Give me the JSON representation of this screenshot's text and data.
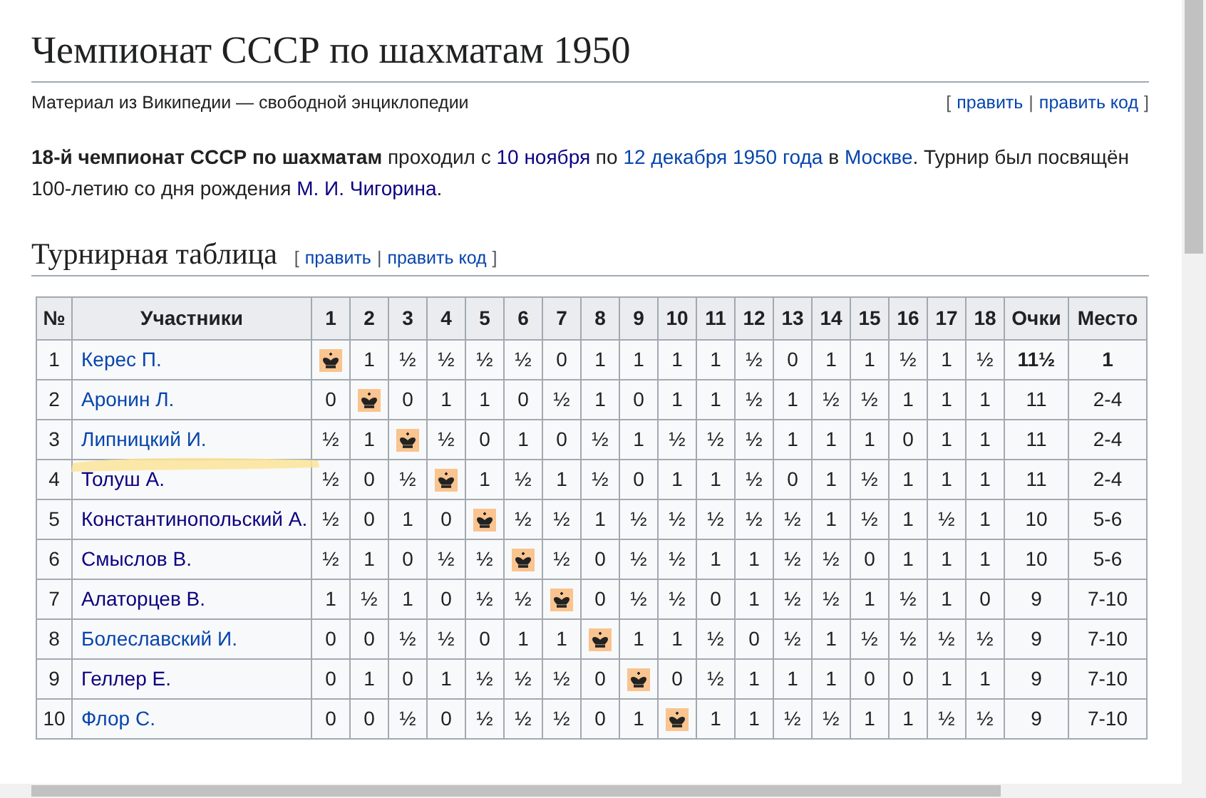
{
  "title": "Чемпионат СССР по шахматам 1950",
  "tagline": "Материал из Википедии — свободной энциклопедии",
  "page_edit": {
    "open": "[",
    "links": [
      "править",
      "править код"
    ],
    "separator": "|",
    "close": "]"
  },
  "intro": [
    {
      "kind": "bold",
      "text": "18-й чемпионат СССР по шахматам"
    },
    {
      "kind": "plain",
      "text": " проходил с "
    },
    {
      "kind": "link",
      "text": "10 ноября",
      "visited": true
    },
    {
      "kind": "plain",
      "text": " по "
    },
    {
      "kind": "link",
      "text": "12 декабря 1950 года",
      "visited": false
    },
    {
      "kind": "plain",
      "text": " в "
    },
    {
      "kind": "link",
      "text": "Москве",
      "visited": false
    },
    {
      "kind": "plain",
      "text": ". Турнир был посвящён 100-летию со дня рождения "
    },
    {
      "kind": "link",
      "text": "М. И. Чигорина",
      "visited": true
    },
    {
      "kind": "plain",
      "text": "."
    }
  ],
  "section": {
    "title": "Турнирная таблица",
    "edit": {
      "open": "[",
      "links": [
        "править",
        "править код"
      ],
      "separator": "|",
      "close": "]"
    }
  },
  "table": {
    "columns": [
      "№",
      "Участники",
      "1",
      "2",
      "3",
      "4",
      "5",
      "6",
      "7",
      "8",
      "9",
      "10",
      "11",
      "12",
      "13",
      "14",
      "15",
      "16",
      "17",
      "18",
      "Очки",
      "Место"
    ],
    "rows": [
      {
        "num": "1",
        "name": "Керес П.",
        "visited": false,
        "results": [
          "1",
          "½",
          "½",
          "½",
          "½",
          "0",
          "1",
          "1",
          "1",
          "1",
          "½",
          "0",
          "1",
          "1",
          "½",
          "1",
          "½"
        ],
        "points": "11½",
        "place": "1",
        "leader": true
      },
      {
        "num": "2",
        "name": "Аронин Л.",
        "visited": false,
        "results": [
          "0",
          "0",
          "1",
          "1",
          "0",
          "½",
          "1",
          "0",
          "1",
          "1",
          "½",
          "1",
          "½",
          "½",
          "1",
          "1",
          "1"
        ],
        "points": "11",
        "place": "2-4",
        "leader": false
      },
      {
        "num": "3",
        "name": "Липницкий И.",
        "visited": false,
        "results": [
          "½",
          "1",
          "½",
          "0",
          "1",
          "0",
          "½",
          "1",
          "½",
          "½",
          "½",
          "1",
          "1",
          "1",
          "0",
          "1",
          "1"
        ],
        "points": "11",
        "place": "2-4",
        "leader": false
      },
      {
        "num": "4",
        "name": "Толуш А.",
        "visited": true,
        "results": [
          "½",
          "0",
          "½",
          "1",
          "½",
          "1",
          "½",
          "0",
          "1",
          "1",
          "½",
          "0",
          "1",
          "½",
          "1",
          "1",
          "1"
        ],
        "points": "11",
        "place": "2-4",
        "leader": false
      },
      {
        "num": "5",
        "name": "Константинопольский А.",
        "visited": true,
        "results": [
          "½",
          "0",
          "1",
          "0",
          "½",
          "½",
          "1",
          "½",
          "½",
          "½",
          "½",
          "½",
          "1",
          "½",
          "1",
          "½",
          "1"
        ],
        "points": "10",
        "place": "5-6",
        "leader": false
      },
      {
        "num": "6",
        "name": "Смыслов В.",
        "visited": true,
        "results": [
          "½",
          "1",
          "0",
          "½",
          "½",
          "½",
          "0",
          "½",
          "½",
          "1",
          "1",
          "½",
          "½",
          "0",
          "1",
          "1",
          "1"
        ],
        "points": "10",
        "place": "5-6",
        "leader": false
      },
      {
        "num": "7",
        "name": "Алаторцев В.",
        "visited": true,
        "results": [
          "1",
          "½",
          "1",
          "0",
          "½",
          "½",
          "0",
          "½",
          "½",
          "0",
          "1",
          "½",
          "½",
          "1",
          "½",
          "1",
          "0"
        ],
        "points": "9",
        "place": "7-10",
        "leader": false
      },
      {
        "num": "8",
        "name": "Болеславский И.",
        "visited": false,
        "results": [
          "0",
          "0",
          "½",
          "½",
          "0",
          "1",
          "1",
          "1",
          "1",
          "½",
          "0",
          "½",
          "1",
          "½",
          "½",
          "½",
          "½"
        ],
        "points": "9",
        "place": "7-10",
        "leader": false
      },
      {
        "num": "9",
        "name": "Геллер Е.",
        "visited": true,
        "results": [
          "0",
          "1",
          "0",
          "1",
          "½",
          "½",
          "½",
          "0",
          "0",
          "½",
          "1",
          "1",
          "1",
          "0",
          "0",
          "1",
          "1"
        ],
        "points": "9",
        "place": "7-10",
        "leader": false
      },
      {
        "num": "10",
        "name": "Флор С.",
        "visited": false,
        "results": [
          "0",
          "0",
          "½",
          "0",
          "½",
          "½",
          "½",
          "0",
          "1",
          "1",
          "1",
          "½",
          "½",
          "1",
          "1",
          "½",
          "½"
        ],
        "points": "9",
        "place": "7-10",
        "leader": false
      }
    ]
  }
}
